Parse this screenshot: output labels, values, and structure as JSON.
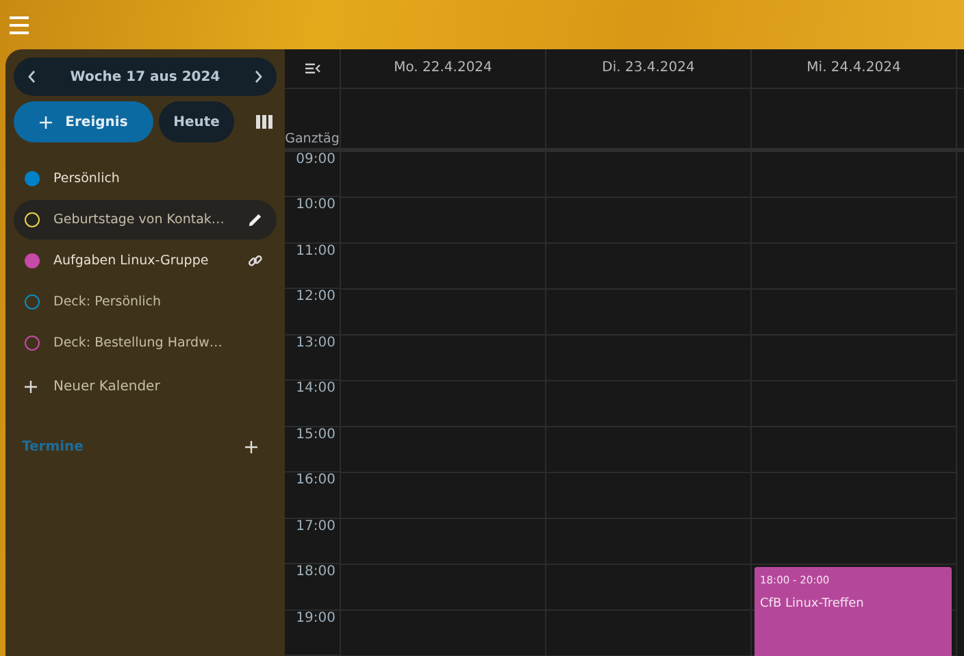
{
  "week_nav": {
    "label": "Woche 17 aus 2024"
  },
  "actions": {
    "new_event": "Ereignis",
    "today": "Heute"
  },
  "calendars": [
    {
      "name": "Persönlich",
      "color": "#0082c9",
      "enabled": true,
      "selected": false,
      "kind": "plain"
    },
    {
      "name": "Geburtstage von Kontak…",
      "color": "#e9d44a",
      "enabled": false,
      "selected": true,
      "kind": "editable"
    },
    {
      "name": "Aufgaben Linux-Gruppe",
      "color": "#c64aa8",
      "enabled": true,
      "selected": false,
      "kind": "shared"
    },
    {
      "name": "Deck: Persönlich",
      "color": "#0a8fc0",
      "enabled": false,
      "selected": false,
      "kind": "plain"
    },
    {
      "name": "Deck: Bestellung Hardw…",
      "color": "#c64aa8",
      "enabled": false,
      "selected": false,
      "kind": "plain"
    }
  ],
  "new_calendar": "Neuer Kalender",
  "appointments_section": "Termine",
  "allday_label": "Ganztäg",
  "days": [
    {
      "label": "Mo. 22.4.2024"
    },
    {
      "label": "Di. 23.4.2024"
    },
    {
      "label": "Mi. 24.4.2024",
      "events": [
        {
          "time": "18:00 - 20:00",
          "title": "CfB Linux-Treffen",
          "color": "#b5479b"
        }
      ]
    }
  ],
  "hours": [
    "09:00",
    "10:00",
    "11:00",
    "12:00",
    "13:00",
    "14:00",
    "15:00",
    "16:00",
    "17:00",
    "18:00",
    "19:00"
  ]
}
